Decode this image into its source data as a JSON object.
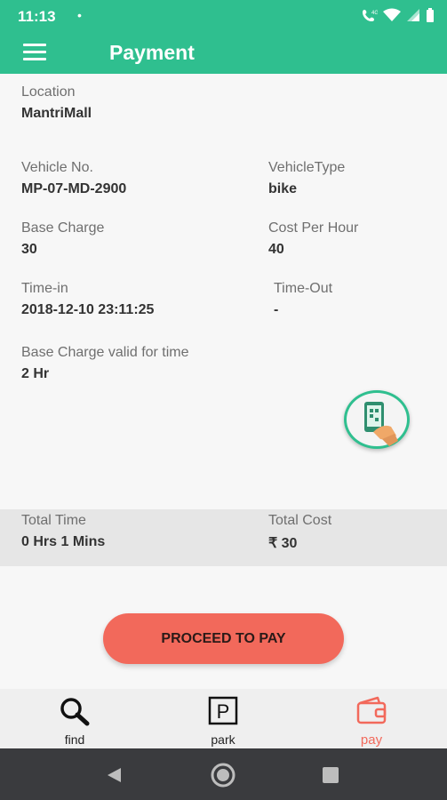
{
  "status": {
    "time": "11:13",
    "dot": "•"
  },
  "appbar": {
    "title": "Payment"
  },
  "details": {
    "location": {
      "label": "Location",
      "value": "MantriMall"
    },
    "vehicle_no": {
      "label": "Vehicle No.",
      "value": "MP-07-MD-2900"
    },
    "vehicle_type": {
      "label": "VehicleType",
      "value": "bike"
    },
    "base_charge": {
      "label": "Base Charge",
      "value": "30"
    },
    "cost_per_hour": {
      "label": "Cost Per Hour",
      "value": "40"
    },
    "time_in": {
      "label": "Time-in",
      "value": "2018-12-10 23:11:25"
    },
    "time_out": {
      "label": "Time-Out",
      "value": "-"
    },
    "base_valid": {
      "label": "Base Charge valid for time",
      "value": "2 Hr"
    }
  },
  "totals": {
    "total_time": {
      "label": "Total Time",
      "value": "0 Hrs 1 Mins"
    },
    "total_cost": {
      "label": "Total Cost",
      "value": "₹ 30"
    }
  },
  "actions": {
    "proceed_label": "PROCEED TO PAY"
  },
  "tabs": [
    {
      "label": "find",
      "icon": "search-icon"
    },
    {
      "label": "park",
      "icon": "parking-icon"
    },
    {
      "label": "pay",
      "icon": "wallet-icon"
    }
  ],
  "colors": {
    "primary": "#2fbf8f",
    "accent": "#f2695b"
  }
}
